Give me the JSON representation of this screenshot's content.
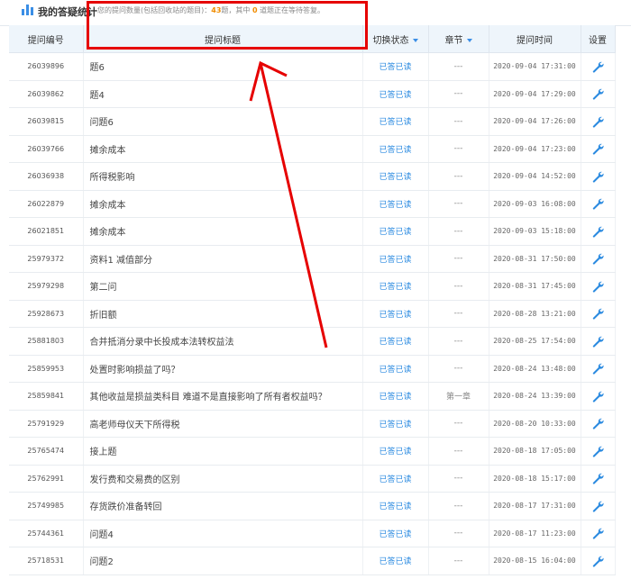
{
  "header": {
    "title": "我的答疑统计",
    "summary_prefix": "您的提问数量(包括回收站的题目)：",
    "total_count": "43",
    "summary_mid": "题，其中",
    "waiting_count": "0",
    "summary_suffix": "道题正在等待答复。"
  },
  "table": {
    "columns": {
      "id": "提问编号",
      "title": "提问标题",
      "status": "切换状态",
      "chapter": "章节",
      "time": "提问时间",
      "settings": "设置"
    },
    "rows": [
      {
        "id": "26039896",
        "title": "题6",
        "status": "已答已读",
        "chapter": "---",
        "time": "2020-09-04 17:31:00"
      },
      {
        "id": "26039862",
        "title": "题4",
        "status": "已答已读",
        "chapter": "---",
        "time": "2020-09-04 17:29:00"
      },
      {
        "id": "26039815",
        "title": "问题6",
        "status": "已答已读",
        "chapter": "---",
        "time": "2020-09-04 17:26:00"
      },
      {
        "id": "26039766",
        "title": "摊余成本",
        "status": "已答已读",
        "chapter": "---",
        "time": "2020-09-04 17:23:00"
      },
      {
        "id": "26036938",
        "title": "所得税影响",
        "status": "已答已读",
        "chapter": "---",
        "time": "2020-09-04 14:52:00"
      },
      {
        "id": "26022879",
        "title": "摊余成本",
        "status": "已答已读",
        "chapter": "---",
        "time": "2020-09-03 16:08:00"
      },
      {
        "id": "26021851",
        "title": "摊余成本",
        "status": "已答已读",
        "chapter": "---",
        "time": "2020-09-03 15:18:00"
      },
      {
        "id": "25979372",
        "title": "资料1 减值部分",
        "status": "已答已读",
        "chapter": "---",
        "time": "2020-08-31 17:50:00"
      },
      {
        "id": "25979298",
        "title": "第二问",
        "status": "已答已读",
        "chapter": "---",
        "time": "2020-08-31 17:45:00"
      },
      {
        "id": "25928673",
        "title": "折旧额",
        "status": "已答已读",
        "chapter": "---",
        "time": "2020-08-28 13:21:00"
      },
      {
        "id": "25881803",
        "title": "合并抵消分录中长投成本法转权益法",
        "status": "已答已读",
        "chapter": "---",
        "time": "2020-08-25 17:54:00"
      },
      {
        "id": "25859953",
        "title": "处置时影响损益了吗？",
        "status": "已答已读",
        "chapter": "---",
        "time": "2020-08-24 13:48:00"
      },
      {
        "id": "25859841",
        "title": "其他收益是损益类科目 难道不是直接影响了所有者权益吗？",
        "status": "已答已读",
        "chapter": "第一章",
        "time": "2020-08-24 13:39:00"
      },
      {
        "id": "25791929",
        "title": "高老师母仪天下所得税",
        "status": "已答已读",
        "chapter": "---",
        "time": "2020-08-20 10:33:00"
      },
      {
        "id": "25765474",
        "title": "接上题",
        "status": "已答已读",
        "chapter": "---",
        "time": "2020-08-18 17:05:00"
      },
      {
        "id": "25762991",
        "title": "发行费和交易费的区别",
        "status": "已答已读",
        "chapter": "---",
        "time": "2020-08-18 15:17:00"
      },
      {
        "id": "25749985",
        "title": "存货跌价准备转回",
        "status": "已答已读",
        "chapter": "---",
        "time": "2020-08-17 17:31:00"
      },
      {
        "id": "25744361",
        "title": "问题4",
        "status": "已答已读",
        "chapter": "---",
        "time": "2020-08-17 11:23:00"
      },
      {
        "id": "25718531",
        "title": "问题2",
        "status": "已答已读",
        "chapter": "---",
        "time": "2020-08-15 16:04:00"
      }
    ]
  },
  "icons": {
    "header": "bar-chart-icon",
    "settings": "wrench-icon",
    "sort": "caret-down-icon"
  },
  "colors": {
    "accent": "#2a8ae0",
    "count_highlight": "#f08c00",
    "header_bg": "#eef5fb",
    "annotation": "#e60000"
  }
}
